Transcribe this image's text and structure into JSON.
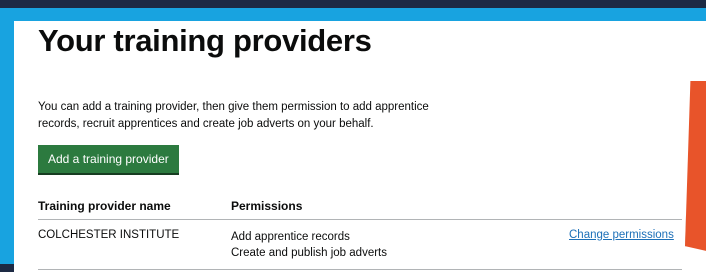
{
  "page": {
    "title": "Your training providers",
    "intro_line1": "You can add a training provider, then give them permission to add apprentice",
    "intro_line2": "records, recruit apprentices and create job adverts on your behalf."
  },
  "actions": {
    "add_provider_label": "Add a training provider"
  },
  "table": {
    "headers": [
      "Training provider name",
      "Permissions"
    ],
    "rows": [
      {
        "name": "COLCHESTER INSTITUTE",
        "permissions": [
          "Add apprentice records",
          "Create and publish job adverts"
        ],
        "action_label": "Change permissions"
      }
    ]
  },
  "colors": {
    "primary_button": "#2c7a3f",
    "link": "#1d70b8",
    "frame": "#18a3e0",
    "highlight_arrow": "#e8542a"
  }
}
